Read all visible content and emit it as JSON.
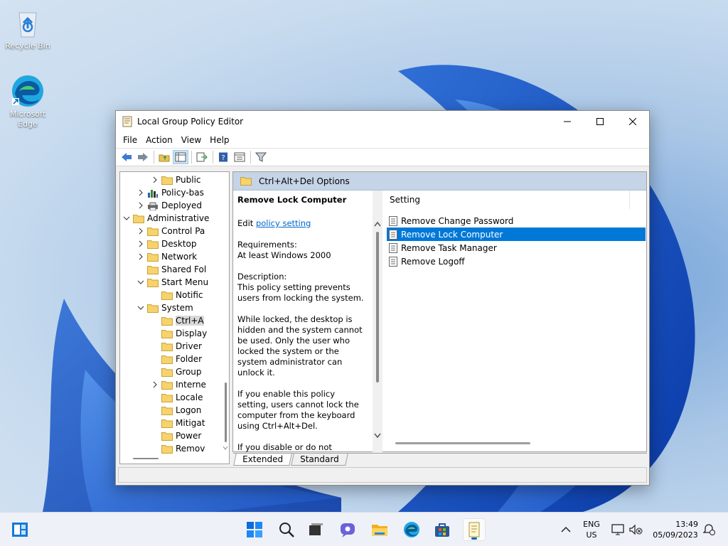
{
  "desktop": {
    "icons": [
      {
        "label": "Recycle Bin",
        "icon": "recycle-bin-icon"
      },
      {
        "label": "Microsoft Edge",
        "icon": "edge-icon"
      }
    ]
  },
  "window": {
    "title": "Local Group Policy Editor",
    "menu": [
      "File",
      "Action",
      "View",
      "Help"
    ],
    "toolbar_icons": [
      "back-icon",
      "forward-icon",
      "up-folder-icon",
      "show-hide-tree-icon",
      "export-list-icon",
      "help-icon",
      "properties-icon",
      "filter-icon"
    ],
    "tree": [
      {
        "label": "Public",
        "expander": ">"
      },
      {
        "label": "Policy-bas",
        "expander": ">"
      },
      {
        "label": "Deployed",
        "expander": ">"
      },
      {
        "label": "Administrative",
        "expander": "v"
      },
      {
        "label": "Control Pa",
        "expander": ">"
      },
      {
        "label": "Desktop",
        "expander": ">"
      },
      {
        "label": "Network",
        "expander": ">"
      },
      {
        "label": "Shared Fol",
        "expander": ""
      },
      {
        "label": "Start Menu",
        "expander": "v"
      },
      {
        "label": "Notific",
        "expander": ""
      },
      {
        "label": "System",
        "expander": "v"
      },
      {
        "label": "Ctrl+A",
        "expander": ""
      },
      {
        "label": "Display",
        "expander": ""
      },
      {
        "label": "Driver",
        "expander": ""
      },
      {
        "label": "Folder",
        "expander": ""
      },
      {
        "label": "Group",
        "expander": ""
      },
      {
        "label": "Interne",
        "expander": ">"
      },
      {
        "label": "Locale",
        "expander": ""
      },
      {
        "label": "Logon",
        "expander": ""
      },
      {
        "label": "Mitigat",
        "expander": ""
      },
      {
        "label": "Power",
        "expander": ""
      },
      {
        "label": "Remov",
        "expander": ""
      }
    ],
    "right_header": "Ctrl+Alt+Del Options",
    "description": {
      "title": "Remove Lock Computer",
      "edit_prefix": "Edit ",
      "edit_link": "policy setting ",
      "requirements_label": "Requirements:",
      "requirements_value": "At least Windows 2000",
      "description_label": "Description:",
      "p1": "This policy setting prevents users from locking the system.",
      "p2": "While locked, the desktop is hidden and the system cannot be used. Only the user who locked the system or the system administrator can unlock it.",
      "p3": "If you enable this policy setting, users cannot lock the computer from the keyboard using Ctrl+Alt+Del.",
      "p4": "If you disable or do not configure this policy setting, users will be"
    },
    "list_header": "Setting",
    "settings": [
      {
        "label": "Remove Change Password",
        "selected": false
      },
      {
        "label": "Remove Lock Computer",
        "selected": true
      },
      {
        "label": "Remove Task Manager",
        "selected": false
      },
      {
        "label": "Remove Logoff",
        "selected": false
      }
    ],
    "tabs": [
      "Extended",
      "Standard"
    ]
  },
  "taskbar": {
    "apps": [
      "widgets-icon",
      "start-icon",
      "search-icon",
      "task-view-icon",
      "chat-icon",
      "file-explorer-icon",
      "edge-icon",
      "store-icon",
      "group-policy-editor-icon"
    ],
    "tray": {
      "language_line1": "ENG",
      "language_line2": "US",
      "time": "13:49",
      "date": "05/09/2023"
    }
  },
  "colors": {
    "selection": "#0078d7",
    "accent": "#0067c0",
    "header_bar": "#c5d4e6"
  }
}
